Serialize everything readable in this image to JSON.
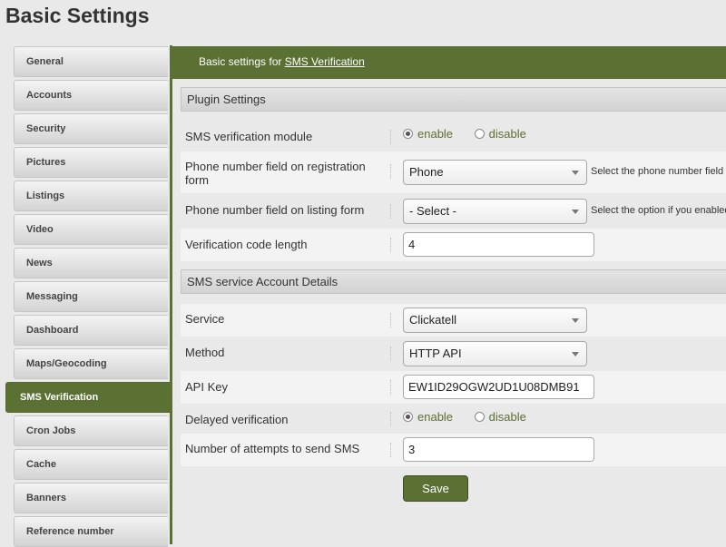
{
  "page": {
    "title": "Basic Settings"
  },
  "sidebar": {
    "items": [
      {
        "label": "General"
      },
      {
        "label": "Accounts"
      },
      {
        "label": "Security"
      },
      {
        "label": "Pictures"
      },
      {
        "label": "Listings"
      },
      {
        "label": "Video"
      },
      {
        "label": "News"
      },
      {
        "label": "Messaging"
      },
      {
        "label": "Dashboard"
      },
      {
        "label": "Maps/Geocoding"
      },
      {
        "label": "SMS Verification",
        "active": true
      },
      {
        "label": "Cron Jobs"
      },
      {
        "label": "Cache"
      },
      {
        "label": "Banners"
      },
      {
        "label": "Reference number"
      }
    ]
  },
  "panel": {
    "header_prefix": "Basic settings for",
    "header_link": "SMS Verification"
  },
  "sections": {
    "plugin": "Plugin Settings",
    "account": "SMS service Account Details"
  },
  "form": {
    "sms_module": {
      "label": "SMS verification module",
      "options": [
        "enable",
        "disable"
      ],
      "selected": "enable"
    },
    "phone_registration": {
      "label": "Phone number field on registration form",
      "value": "Phone",
      "hint": "Select the phone number field"
    },
    "phone_listing": {
      "label": "Phone number field on listing form",
      "value": "- Select -",
      "hint": "Select the option if you enabled"
    },
    "code_length": {
      "label": "Verification code length",
      "value": "4"
    },
    "service": {
      "label": "Service",
      "value": "Clickatell"
    },
    "method": {
      "label": "Method",
      "value": "HTTP API"
    },
    "api_key": {
      "label": "API Key",
      "value": "EW1ID29OGW2UD1U08DMB91"
    },
    "delayed": {
      "label": "Delayed verification",
      "options": [
        "enable",
        "disable"
      ],
      "selected": "enable"
    },
    "attempts": {
      "label": "Number of attempts to send SMS",
      "value": "3"
    }
  },
  "buttons": {
    "save": "Save"
  },
  "colors": {
    "accent": "#5b7033",
    "background": "#e9e9e9"
  }
}
